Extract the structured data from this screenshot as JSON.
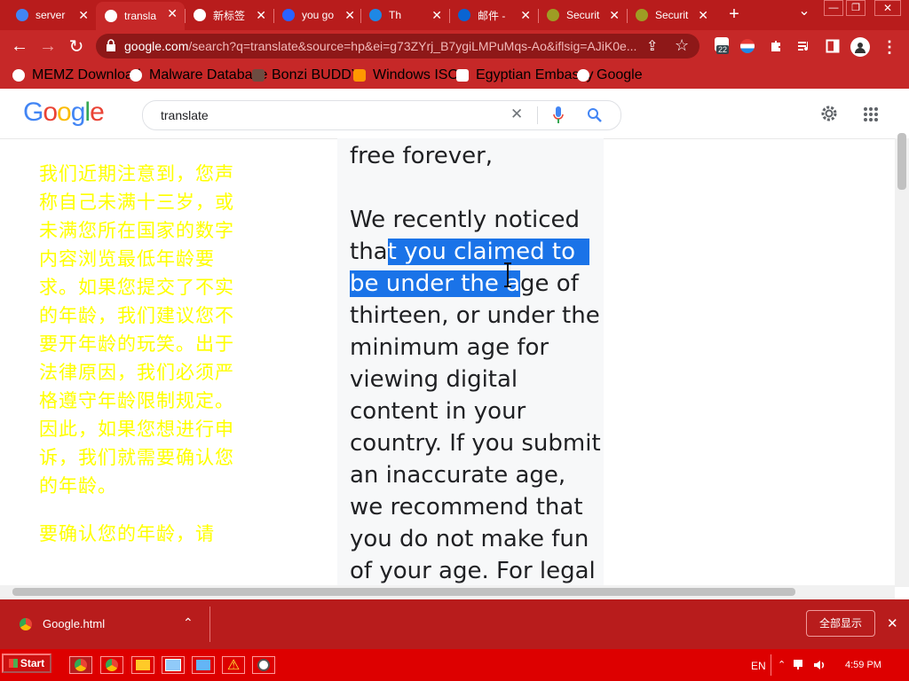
{
  "tabs": [
    {
      "title": "server",
      "color": "#4285f4"
    },
    {
      "title": "transla",
      "color": "#ffffff"
    },
    {
      "title": "新标签",
      "color": "#ffffff"
    },
    {
      "title": "you go",
      "color": "#2962ff"
    },
    {
      "title": "Th",
      "color": "#1e88e5"
    },
    {
      "title": "邮件 -",
      "color": "#0a64d2"
    },
    {
      "title": "Securit",
      "color": "#9e9d24"
    },
    {
      "title": "Securit",
      "color": "#9e9d24"
    }
  ],
  "new_tab_glyph": "+",
  "window": {
    "minimize": "—",
    "restore": "❐",
    "close": "✕",
    "tab_search": "⌄"
  },
  "toolbar": {
    "back": "←",
    "forward": "→",
    "reload": "↻",
    "lock": "🔒",
    "url_domain": "google.com",
    "url_rest": "/search?q=translate&source=hp&ei=g73ZYrj_B7ygiLMPuMqs-Ao&iflsig=AJiK0e...",
    "share": "⇪",
    "star": "☆",
    "ext_badge": "22",
    "puzzle": "🧩",
    "menu": "⋮"
  },
  "bookmarks": [
    {
      "label": "MEMZ Download",
      "color": "#ffffff"
    },
    {
      "label": "Malware Database",
      "color": "#ffffff"
    },
    {
      "label": "Bonzi BUDDY!",
      "color": "#6d4c41"
    },
    {
      "label": "Windows ISOs",
      "color": "#ff9800"
    },
    {
      "label": "Egyptian Embassy",
      "color": "#ffffff"
    },
    {
      "label": "Google",
      "color": "#ffffff"
    }
  ],
  "google": {
    "logo_letters": [
      "G",
      "o",
      "o",
      "g",
      "l",
      "e"
    ],
    "logo_colors": [
      "#4285f4",
      "#ea4335",
      "#fbbc05",
      "#4285f4",
      "#34a853",
      "#ea4335"
    ],
    "search_value": "translate",
    "clear": "✕",
    "mic": "🎤",
    "search_icon": "🔍",
    "settings": "⚙",
    "apps": "⋮⋮⋮"
  },
  "content": {
    "chinese_para1": "我们近期注意到，您声称自己未满十三岁，或 未满您所在国家的数字内容浏览最低年龄要求。如果您提交了不实的年龄，我们建议您不要开年龄的玩笑。出于法律原因，我们必须严格遵守年龄限制规定。因此，如果您想进行申诉，我们就需要确认您的年龄。",
    "chinese_para2": "要确认您的年龄，请",
    "r_line1": "free forever,",
    "r_we": "We recently noticed",
    "r_tha": "tha",
    "r_hl1": "t you claimed to",
    "r_hl2": "be under the a",
    "r_after": "ge of",
    "r_rest": [
      "thirteen, or under the",
      "minimum age for",
      "viewing digital",
      "content in your",
      "country. If you submit",
      "an inaccurate age,",
      "we recommend that",
      "you do not make fun",
      "of your age. For legal"
    ]
  },
  "download": {
    "filename": "Google.html",
    "show_all": "全部显示",
    "close": "✕",
    "chevron": "⌃"
  },
  "taskbar": {
    "start": "Start",
    "lang": "EN",
    "time": "4:59 PM"
  }
}
